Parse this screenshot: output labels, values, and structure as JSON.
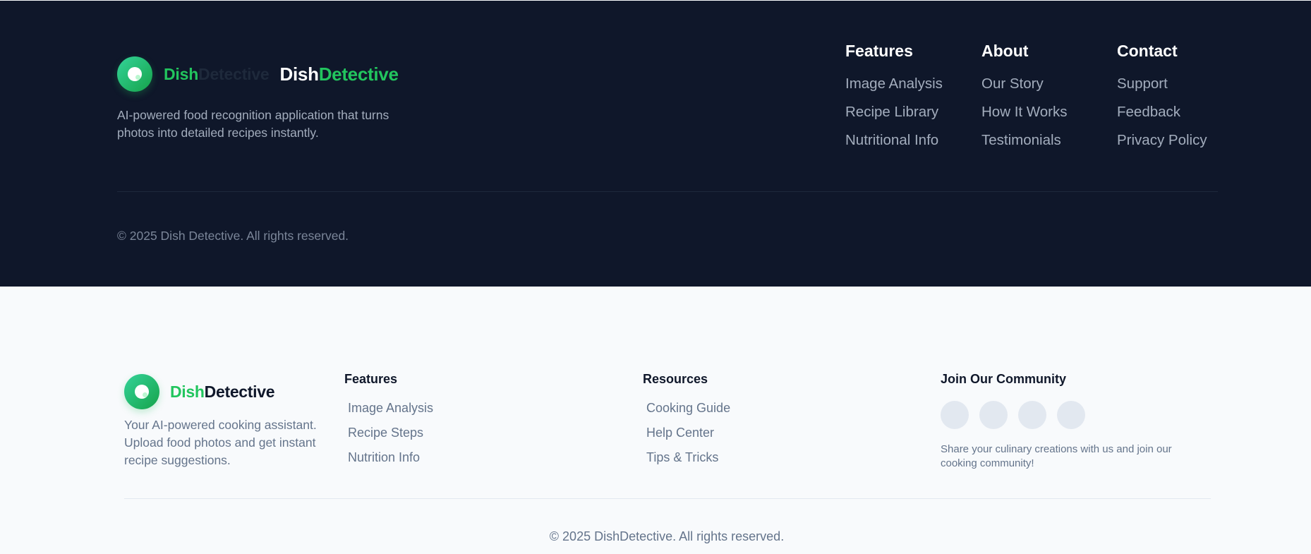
{
  "dark_footer": {
    "brand": {
      "faded": {
        "part1": "Dish",
        "part2": "Detective"
      },
      "main": {
        "part1": "Dish",
        "part2": "Detective"
      }
    },
    "description": "AI-powered food recognition application that turns photos into detailed recipes instantly.",
    "columns": [
      {
        "title": "Features",
        "links": [
          "Image Analysis",
          "Recipe Library",
          "Nutritional Info"
        ]
      },
      {
        "title": "About",
        "links": [
          "Our Story",
          "How It Works",
          "Testimonials"
        ]
      },
      {
        "title": "Contact",
        "links": [
          "Support",
          "Feedback",
          "Privacy Policy"
        ]
      }
    ],
    "copyright": "© 2025 Dish Detective. All rights reserved."
  },
  "light_footer": {
    "brand": {
      "part1": "Dish",
      "part2": "Detective"
    },
    "description": "Your AI-powered cooking assistant. Upload food photos and get instant recipe suggestions.",
    "columns": [
      {
        "title": "Features",
        "links": [
          "Image Analysis",
          "Recipe Steps",
          "Nutrition Info"
        ]
      },
      {
        "title": "Resources",
        "links": [
          "Cooking Guide",
          "Help Center",
          "Tips & Tricks"
        ]
      }
    ],
    "community": {
      "title": "Join Our Community",
      "text": "Share your culinary creations with us and join our cooking community!"
    },
    "copyright": "© 2025 DishDetective. All rights reserved."
  },
  "colors": {
    "dark_bg": "#0f172a",
    "light_bg": "#f8fafc",
    "accent_green": "#22c55e",
    "muted_text": "#64748b"
  }
}
